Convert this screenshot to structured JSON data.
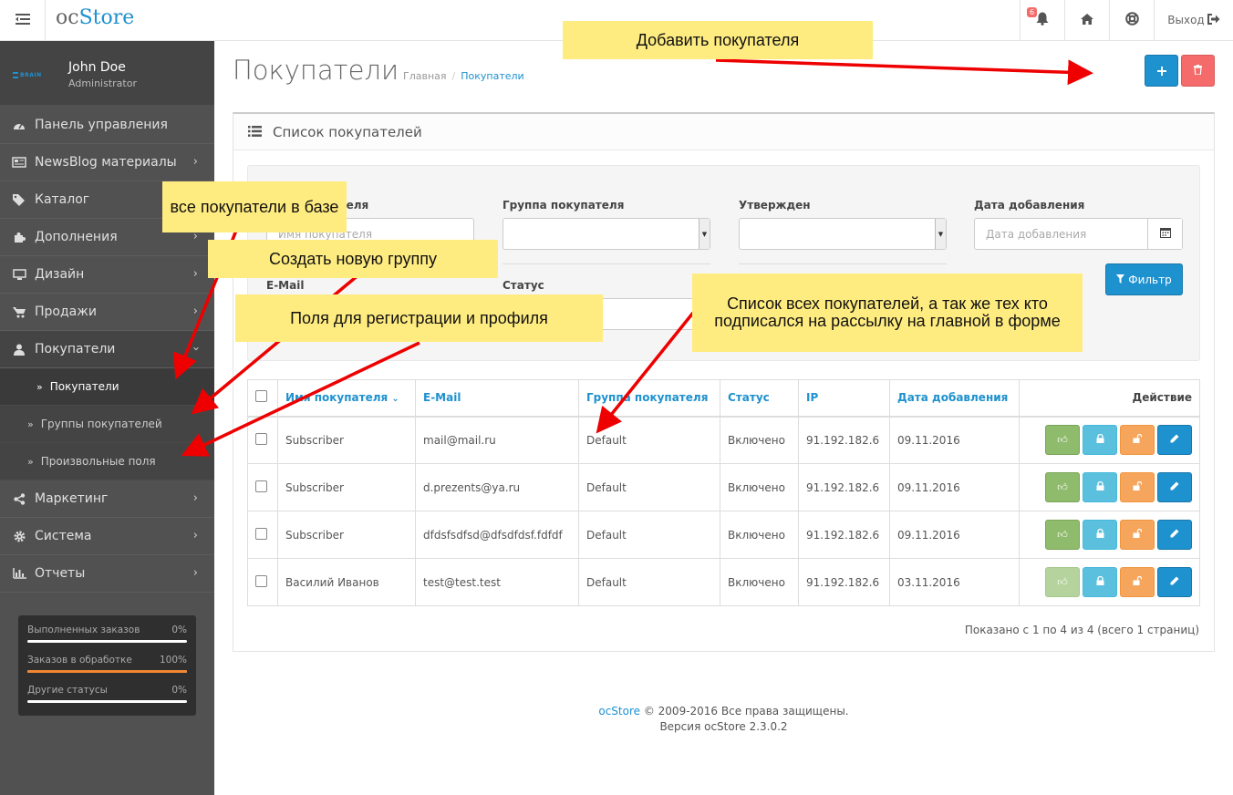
{
  "header": {
    "logo_prefix": "oc",
    "logo_brand": "Store",
    "notification_count": "6",
    "logout_label": "Выход"
  },
  "profile": {
    "name": "John Doe",
    "role": "Administrator",
    "avatar_text": "BRAIN"
  },
  "sidebar": {
    "items": [
      {
        "label": "Панель управления",
        "icon": "dashboard-icon"
      },
      {
        "label": "NewsBlog материалы",
        "icon": "newspaper-icon"
      },
      {
        "label": "Каталог",
        "icon": "tags-icon"
      },
      {
        "label": "Дополнения",
        "icon": "puzzle-icon"
      },
      {
        "label": "Дизайн",
        "icon": "monitor-icon"
      },
      {
        "label": "Продажи",
        "icon": "cart-icon"
      },
      {
        "label": "Покупатели",
        "icon": "user-icon"
      },
      {
        "label": "Маркетинг",
        "icon": "share-icon"
      },
      {
        "label": "Система",
        "icon": "gear-icon"
      },
      {
        "label": "Отчеты",
        "icon": "bar-chart-icon"
      }
    ],
    "sub_items": [
      {
        "label": "Покупатели"
      },
      {
        "label": "Группы покупателей"
      },
      {
        "label": "Произвольные поля"
      }
    ],
    "stats": [
      {
        "label": "Выполненных заказов",
        "value": "0%",
        "fraction": 0
      },
      {
        "label": "Заказов в обработке",
        "value": "100%",
        "fraction": 1
      },
      {
        "label": "Другие статусы",
        "value": "0%",
        "fraction": 0
      }
    ]
  },
  "page": {
    "title": "Покупатели",
    "breadcrumb_home": "Главная",
    "breadcrumb_current": "Покупатели"
  },
  "panel": {
    "title": "Список покупателей"
  },
  "filter": {
    "customer_name_label": "Имя покупателя",
    "customer_name_placeholder": "Имя покупателя",
    "group_label": "Группа покупателя",
    "approved_label": "Утвержден",
    "date_label": "Дата добавления",
    "date_placeholder": "Дата добавления",
    "email_label": "E-Mail",
    "status_label": "Статус",
    "filter_button": "Фильтр"
  },
  "table": {
    "columns": [
      "Имя покупателя",
      "E-Mail",
      "Группа покупателя",
      "Статус",
      "IP",
      "Дата добавления",
      "Действие"
    ],
    "rows": [
      {
        "name": "Subscriber",
        "email": "mail@mail.ru",
        "group": "Default",
        "status": "Включено",
        "ip": "91.192.182.6",
        "date": "09.11.2016"
      },
      {
        "name": "Subscriber",
        "email": "d.prezents@ya.ru",
        "group": "Default",
        "status": "Включено",
        "ip": "91.192.182.6",
        "date": "09.11.2016"
      },
      {
        "name": "Subscriber",
        "email": "dfdsfsdfsd@dfsdfdsf.fdfdf",
        "group": "Default",
        "status": "Включено",
        "ip": "91.192.182.6",
        "date": "09.11.2016"
      },
      {
        "name": "Василий Иванов",
        "email": "test@test.test",
        "group": "Default",
        "status": "Включено",
        "ip": "91.192.182.6",
        "date": "03.11.2016"
      }
    ],
    "pagination_text": "Показано с 1 по 4 из 4 (всего 1 страниц)"
  },
  "footer": {
    "brand": "ocStore",
    "copyright": "© 2009-2016 Все права защищены.",
    "version": "Версия ocStore 2.3.0.2"
  },
  "annotations": {
    "add_customer": "Добавить покупателя",
    "all_customers": "все покупатели в базе",
    "new_group": "Создать новую группу",
    "fields": "Поля для регистрации и профиля",
    "list_all": "Список всех покупателей, а так же тех кто подписался на рассылку на главной в форме"
  },
  "colors": {
    "accent": "#1e91cf",
    "danger": "#f56b6b",
    "annotation_bg": "#ffec80",
    "arrow": "#ee0000"
  }
}
